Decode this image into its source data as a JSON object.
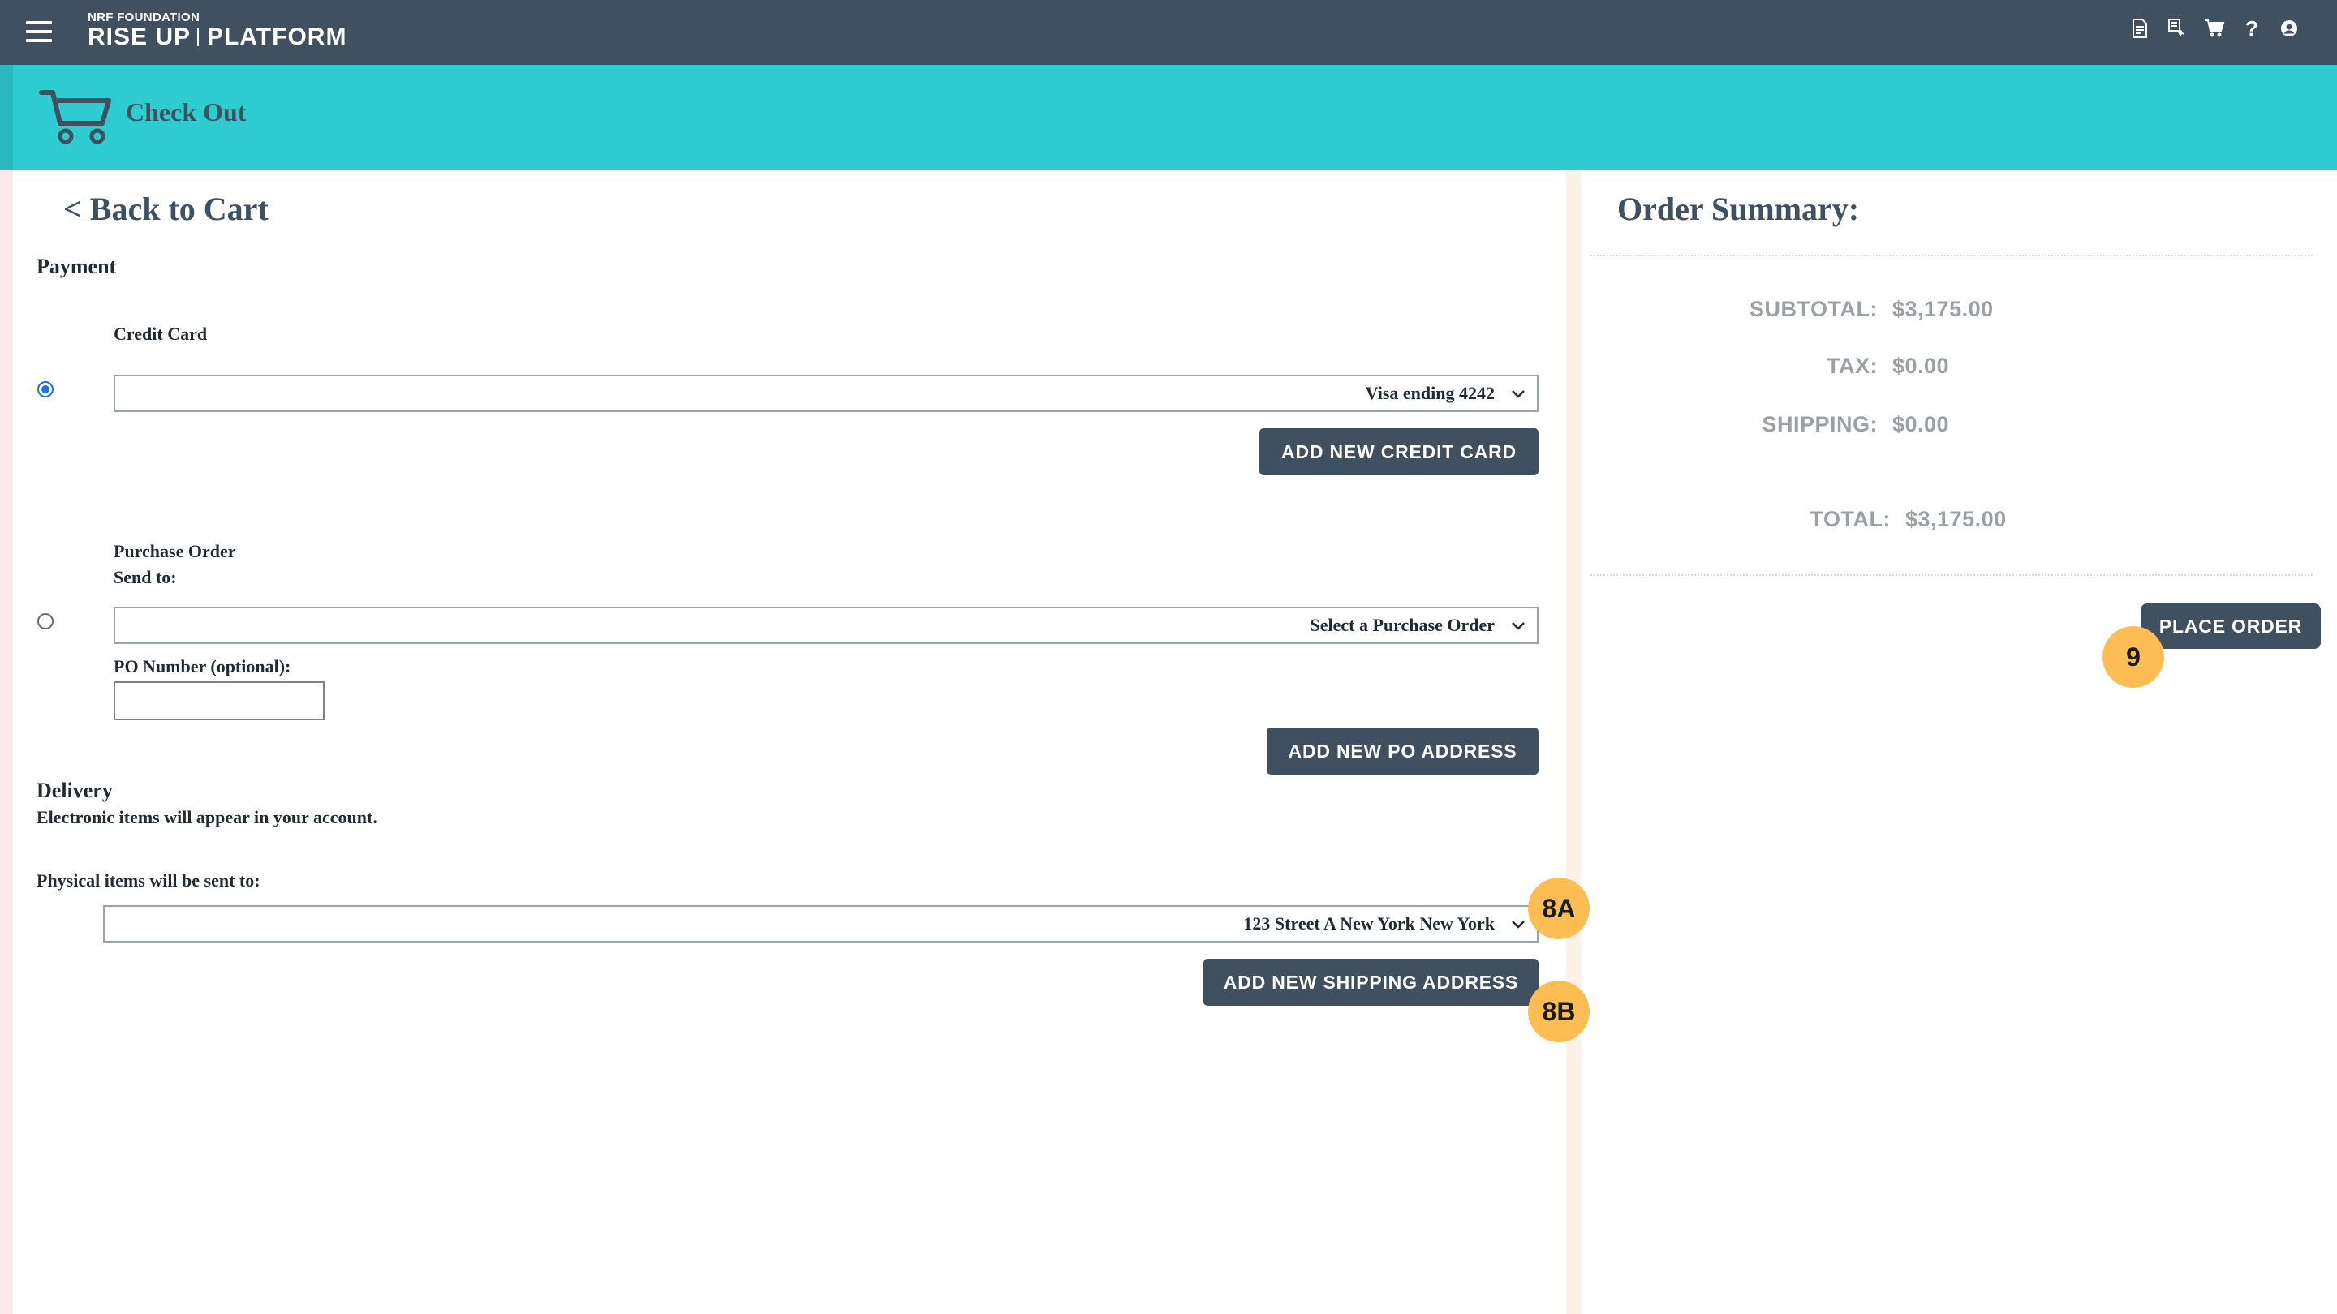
{
  "navbar": {
    "logo_small": "NRF FOUNDATION",
    "logo_left": "RISE UP",
    "logo_right": "PLATFORM",
    "icons": [
      "document-icon",
      "receipt-icon",
      "cart-icon",
      "help-icon",
      "account-icon"
    ],
    "help_glyph": "?"
  },
  "header": {
    "title": "Check Out",
    "icon": "shopping-cart-icon"
  },
  "payment": {
    "back_link": "< Back to Cart",
    "section_title": "Payment",
    "credit_card": {
      "label": "Credit Card",
      "selected": true,
      "select_value": "Visa ending 4242",
      "add_button": "ADD NEW CREDIT CARD"
    },
    "purchase_order": {
      "label": "Purchase Order",
      "send_to": "Send to:",
      "selected": false,
      "select_value": "Select a Purchase Order",
      "po_number_label": "PO Number (optional):",
      "po_number_value": "",
      "add_button": "ADD NEW PO ADDRESS"
    }
  },
  "delivery": {
    "title": "Delivery",
    "electronic_note": "Electronic items will appear in your account.",
    "physical_label": "Physical items will be sent to:",
    "address_value": "123 Street A New York New York",
    "add_button": "ADD NEW SHIPPING ADDRESS"
  },
  "summary": {
    "title": "Order Summary:",
    "subtotal_label": "SUBTOTAL:",
    "subtotal_value": "$3,175.00",
    "tax_label": "TAX:",
    "tax_value": "$0.00",
    "shipping_label": "SHIPPING:",
    "shipping_value": "$0.00",
    "total_label": "TOTAL:",
    "total_value": "$3,175.00",
    "place_order_button": "PLACE ORDER"
  },
  "annotations": {
    "badge_address": "8A",
    "badge_shipping_button": "8B",
    "badge_place_order": "9"
  },
  "colors": {
    "navbar": "#3f5161",
    "header": "#2ecbd1",
    "button": "#3f5161",
    "badge": "#fdbd53",
    "summary_text": "#9aa1a6"
  }
}
